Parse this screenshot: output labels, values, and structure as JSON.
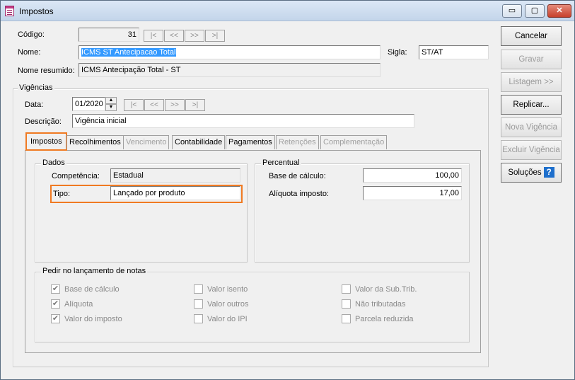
{
  "window": {
    "title": "Impostos",
    "min_label": "▭",
    "max_label": "▢",
    "close_label": "✕"
  },
  "form": {
    "codigo_label": "Código:",
    "codigo_value": "31",
    "nome_label": "Nome:",
    "nome_value": "ICMS ST Antecipacao Total",
    "sigla_label": "Sigla:",
    "sigla_value": "ST/AT",
    "nome_resumido_label": "Nome resumido:",
    "nome_resumido_value": "ICMS Antecipação Total - ST"
  },
  "nav": [
    "|<",
    "<<",
    ">>",
    ">|"
  ],
  "vigencias": {
    "group_title": "Vigências",
    "data_label": "Data:",
    "data_value": "01/2020",
    "descricao_label": "Descrição:",
    "descricao_value": "Vigência inicial"
  },
  "tabs": [
    {
      "label": "Impostos",
      "state": "active"
    },
    {
      "label": "Recolhimentos",
      "state": "enabled"
    },
    {
      "label": "Vencimento",
      "state": "disabled"
    },
    {
      "label": "Contabilidade",
      "state": "enabled"
    },
    {
      "label": "Pagamentos",
      "state": "enabled"
    },
    {
      "label": "Retenções",
      "state": "disabled"
    },
    {
      "label": "Complementação",
      "state": "disabled"
    }
  ],
  "dados": {
    "group_title": "Dados",
    "competencia_label": "Competência:",
    "competencia_value": "Estadual",
    "tipo_label": "Tipo:",
    "tipo_value": "Lançado por produto"
  },
  "percentual": {
    "group_title": "Percentual",
    "base_label": "Base de cálculo:",
    "base_value": "100,00",
    "aliquota_label": "Alíquota imposto:",
    "aliquota_value": "17,00"
  },
  "pedir": {
    "group_title": "Pedir no lançamento de notas",
    "col1": [
      {
        "label": "Base de cálculo",
        "checked": true
      },
      {
        "label": "Alíquota",
        "checked": true
      },
      {
        "label": "Valor do imposto",
        "checked": true
      }
    ],
    "col2": [
      {
        "label": "Valor isento",
        "checked": false
      },
      {
        "label": "Valor outros",
        "checked": false
      },
      {
        "label": "Valor do IPI",
        "checked": false
      }
    ],
    "col3": [
      {
        "label": "Valor da Sub.Trib.",
        "checked": false
      },
      {
        "label": "Não tributadas",
        "checked": false
      },
      {
        "label": "Parcela reduzida",
        "checked": false
      }
    ]
  },
  "buttons": {
    "cancelar": "Cancelar",
    "gravar": "Gravar",
    "listagem": "Listagem >>",
    "replicar": "Replicar...",
    "nova_vigencia": "Nova Vigência",
    "excluir_vigencia": "Excluir Vigência",
    "solucoes": "Soluções",
    "help": "?"
  },
  "colors": {
    "highlight": "#f07a22",
    "selection": "#3399ff"
  }
}
